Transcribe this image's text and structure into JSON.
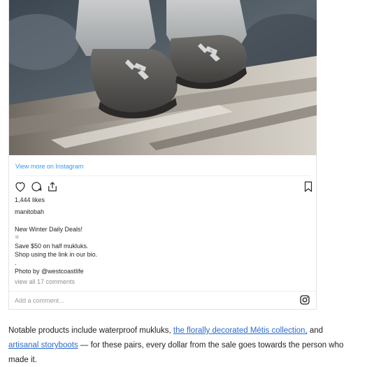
{
  "instagram_embed": {
    "view_more": "View more on Instagram",
    "likes": "1,444 likes",
    "owner": "manitobah",
    "caption": {
      "line1": "New Winter Daily Deals!",
      "snowflake": "❄",
      "line2": "Save $50 on half mukluks.",
      "line3": "Shop using the link in our bio.",
      "dot": ".",
      "line4": "Photo by @westcoastlife"
    },
    "comments_link": "view all 17 comments",
    "add_comment_placeholder": "Add a comment...",
    "icons": {
      "like": "heart-icon",
      "comment": "comment-icon",
      "share": "share-icon",
      "save": "bookmark-icon",
      "logo": "instagram-icon"
    }
  },
  "article": {
    "text_before": "Notable products include waterproof mukluks, ",
    "link1": "the florally decorated Métis collection,",
    "text_mid": " and ",
    "link2": "artisanal storyboots",
    "text_after": " — for these pairs, every dollar from the sale goes towards the person who made it."
  },
  "colors": {
    "link": "#2b6bcc",
    "instagram_link": "#3897f0",
    "border": "#e3e3e3"
  }
}
